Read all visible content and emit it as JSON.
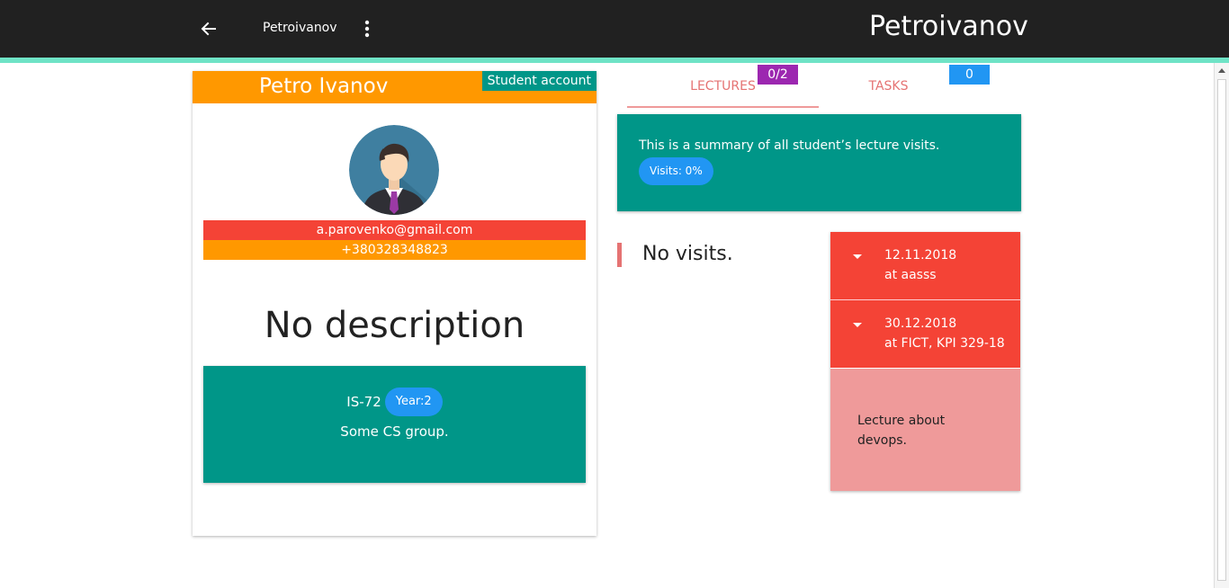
{
  "topbar": {
    "username": "Petroivanov",
    "title": "Petroivanov"
  },
  "icons": {
    "back": "arrow-left-icon",
    "menu": "more-vertical-icon",
    "expand": "caret-down-icon"
  },
  "colors": {
    "topbar": "#212121",
    "accent_line": "#6fe3c6",
    "orange": "#ff9800",
    "teal": "#009688",
    "red": "#f44336",
    "blue": "#2196f3",
    "purple": "#9c27b0",
    "pink": "#ef9a9a"
  },
  "profile": {
    "name": "Petro Ivanov",
    "account_type": "Student account",
    "email": "a.parovenko@gmail.com",
    "phone": "+380328348823",
    "description": "No description",
    "group": {
      "name": "IS-72",
      "year_label": "Year:2",
      "description": "Some CS group."
    }
  },
  "tabs": [
    {
      "label": "LECTURES",
      "badge": "0/2"
    },
    {
      "label": "TASKS",
      "badge": "0"
    }
  ],
  "summary": {
    "text": "This is a summary of all student’s lecture visits.",
    "visits_label": "Visits: 0%"
  },
  "no_visits": "No visits.",
  "lectures": [
    {
      "date": "12.11.2018",
      "place": "at aasss"
    },
    {
      "date": "30.12.2018",
      "place": "at FICT, KPI 329-18"
    }
  ],
  "lecture_detail": "Lecture about devops."
}
